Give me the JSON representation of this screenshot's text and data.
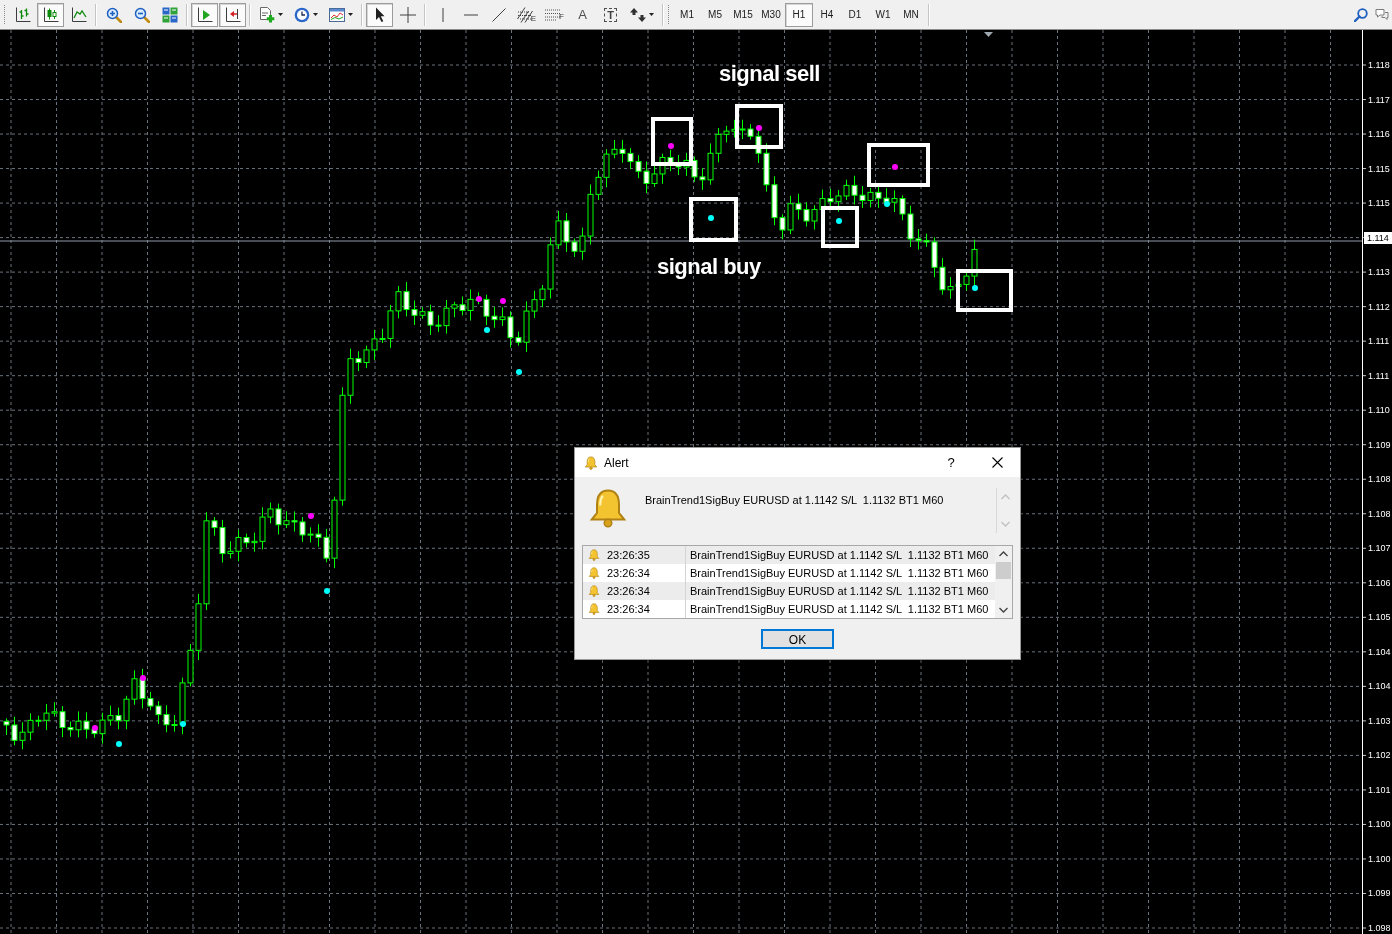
{
  "toolbar": {
    "groups": [
      {
        "buttons": [
          {
            "kind": "bar-chart",
            "pressed": false
          },
          {
            "kind": "candlestick-chart",
            "pressed": true
          },
          {
            "kind": "line-chart",
            "pressed": false
          }
        ]
      },
      {
        "buttons": [
          {
            "kind": "zoom-in",
            "pressed": false
          },
          {
            "kind": "zoom-out",
            "pressed": false
          },
          {
            "kind": "tile-windows",
            "pressed": false
          }
        ]
      },
      {
        "buttons": [
          {
            "kind": "auto-scroll",
            "pressed": true
          },
          {
            "kind": "chart-shift",
            "pressed": true
          }
        ]
      },
      {
        "buttons": [
          {
            "kind": "indicators",
            "pressed": false
          },
          {
            "kind": "periods",
            "pressed": false
          },
          {
            "kind": "templates",
            "pressed": false
          }
        ]
      },
      {
        "buttons": [
          {
            "kind": "cursor",
            "pressed": true
          },
          {
            "kind": "crosshair",
            "pressed": false
          }
        ]
      },
      {
        "buttons": [
          {
            "kind": "vertical-line",
            "pressed": false
          },
          {
            "kind": "horizontal-line",
            "pressed": false
          },
          {
            "kind": "trendline",
            "pressed": false
          },
          {
            "kind": "channel",
            "pressed": false,
            "glyph": "E"
          },
          {
            "kind": "fibonacci",
            "pressed": false,
            "glyph": "F"
          },
          {
            "kind": "text",
            "pressed": false,
            "glyph": "A"
          },
          {
            "kind": "text-label",
            "pressed": false,
            "glyph": "T"
          },
          {
            "kind": "arrows",
            "pressed": false
          }
        ]
      }
    ],
    "timeframes": [
      {
        "label": "M1",
        "selected": false
      },
      {
        "label": "M5",
        "selected": false
      },
      {
        "label": "M15",
        "selected": false
      },
      {
        "label": "M30",
        "selected": false
      },
      {
        "label": "H1",
        "selected": true
      },
      {
        "label": "H4",
        "selected": false
      },
      {
        "label": "D1",
        "selected": false
      },
      {
        "label": "W1",
        "selected": false
      },
      {
        "label": "MN",
        "selected": false
      }
    ]
  },
  "chart": {
    "annotations": [
      {
        "text": "signal sell"
      },
      {
        "text": "signal buy"
      }
    ],
    "price_axis": {
      "labels": [
        {
          "text": "1.118",
          "kind": "tick"
        },
        {
          "text": "1.117",
          "kind": "tick"
        },
        {
          "text": "1.116",
          "kind": "tick"
        },
        {
          "text": "1.115",
          "kind": "tick"
        },
        {
          "text": "1.115",
          "kind": "tick"
        },
        {
          "text": "1.114",
          "kind": "current"
        },
        {
          "text": "1.113",
          "kind": "tick"
        },
        {
          "text": "1.112",
          "kind": "tick"
        },
        {
          "text": "1.111",
          "kind": "tick"
        },
        {
          "text": "1.111",
          "kind": "tick"
        },
        {
          "text": "1.110",
          "kind": "tick"
        },
        {
          "text": "1.109",
          "kind": "tick"
        },
        {
          "text": "1.108",
          "kind": "tick"
        },
        {
          "text": "1.108",
          "kind": "tick"
        },
        {
          "text": "1.107",
          "kind": "tick"
        },
        {
          "text": "1.106",
          "kind": "tick"
        },
        {
          "text": "1.105",
          "kind": "tick"
        },
        {
          "text": "1.104",
          "kind": "tick"
        },
        {
          "text": "1.104",
          "kind": "tick"
        },
        {
          "text": "1.103",
          "kind": "tick"
        },
        {
          "text": "1.102",
          "kind": "tick"
        },
        {
          "text": "1.101",
          "kind": "tick"
        },
        {
          "text": "1.100",
          "kind": "tick"
        },
        {
          "text": "1.100",
          "kind": "tick"
        },
        {
          "text": "1.099",
          "kind": "tick"
        },
        {
          "text": "1.098",
          "kind": "tick"
        }
      ]
    }
  },
  "alert_dialog": {
    "title": "Alert",
    "help": "?",
    "message": "BrainTrend1SigBuy EURUSD at 1.1142 S/L  1.1132 BT1 M60",
    "entries": [
      {
        "time": "23:26:35",
        "message": "BrainTrend1SigBuy EURUSD at 1.1142 S/L  1.1132 BT1 M60"
      },
      {
        "time": "23:26:34",
        "message": "BrainTrend1SigBuy EURUSD at 1.1142 S/L  1.1132 BT1 M60"
      },
      {
        "time": "23:26:34",
        "message": "BrainTrend1SigBuy EURUSD at 1.1142 S/L  1.1132 BT1 M60"
      },
      {
        "time": "23:26:34",
        "message": "BrainTrend1SigBuy EURUSD at 1.1142 S/L  1.1132 BT1 M60"
      }
    ],
    "ok_button": "OK"
  }
}
